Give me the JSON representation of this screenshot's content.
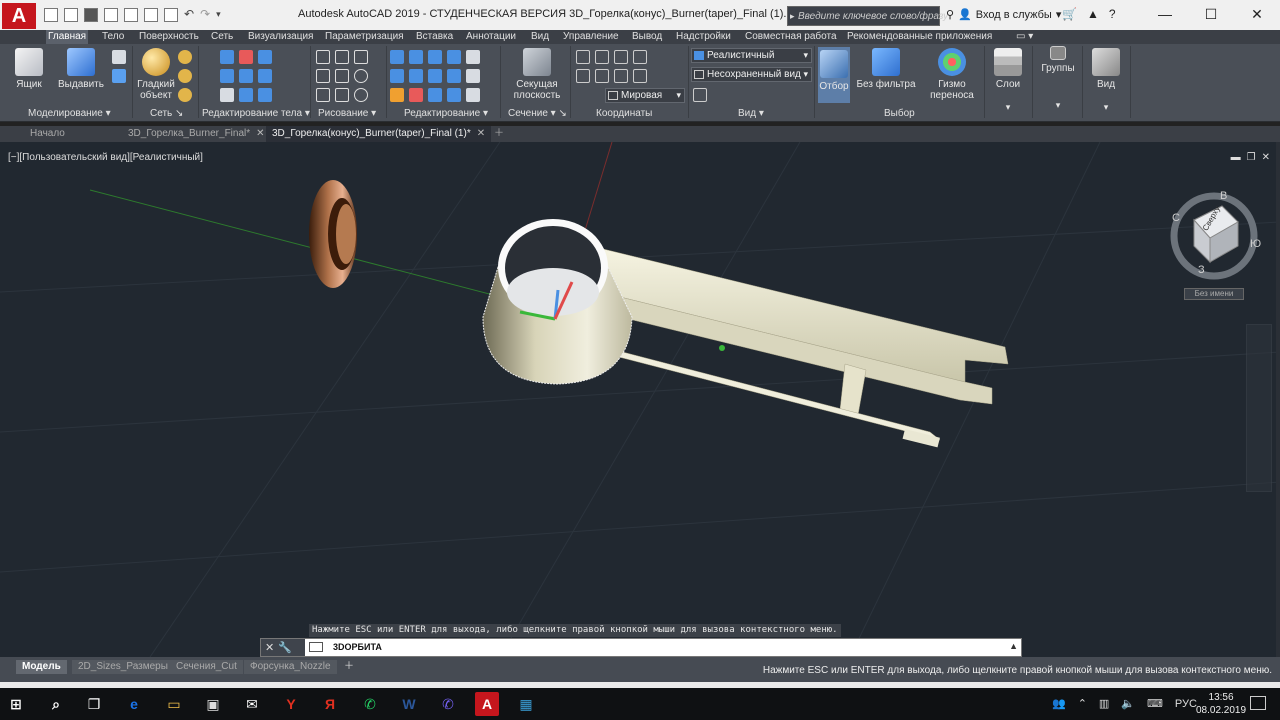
{
  "title_bar": {
    "app_logo": "A",
    "window_title": "Autodesk AutoCAD 2019 - СТУДЕНЧЕСКАЯ ВЕРСИЯ    3D_Горелка(конус)_Burner(taper)_Final (1).dwg",
    "search_placeholder": "Введите ключевое слово/фразу",
    "signin_label": "Вход в службы",
    "window_controls": [
      "—",
      "☐",
      "✕"
    ]
  },
  "ribbon_tabs": [
    "Главная",
    "Тело",
    "Поверхность",
    "Сеть",
    "Визуализация",
    "Параметризация",
    "Вставка",
    "Аннотации",
    "Вид",
    "Управление",
    "Вывод",
    "Надстройки",
    "Совместная работа",
    "Рекомендованные приложения"
  ],
  "ribbon": {
    "box_label": "Ящик",
    "extrude_label": "Выдавить",
    "smooth_label_1": "Гладкий",
    "smooth_label_2": "объект",
    "section_plane_label_1": "Секущая",
    "section_plane_label_2": "плоскость",
    "visual_style": "Реалистичный",
    "saved_view": "Несохраненный вид",
    "ucs": "Мировая",
    "culling_label": "Отбор",
    "no_filter_label": "Без фильтра",
    "gizmo_label_1": "Гизмо",
    "gizmo_label_2": "переноса",
    "layers_label": "Слои",
    "groups_label": "Группы",
    "view_label": "Вид",
    "panels": {
      "modeling": "Моделирование ▾",
      "mesh": "Сеть ↘",
      "solid_edit": "Редактирование тела ▾",
      "draw": "Рисование ▾",
      "modify": "Редактирование ▾",
      "section": "Сечение ▾ ↘",
      "coordinates": "Координаты",
      "view": "Вид ▾",
      "selection": "Выбор"
    }
  },
  "doc_tabs": [
    "Начало",
    "3D_Горелка_Burner_Final*",
    "3D_Горелка(конус)_Burner(taper)_Final (1)*"
  ],
  "viewport": {
    "label": "[−][Пользовательский вид][Реалистичный]",
    "viewcube_face": "Сверху",
    "compass": [
      "С",
      "В",
      "Ю",
      "З"
    ],
    "no_name": "Без имени"
  },
  "command": {
    "message": "Нажмите ESC или ENTER для выхода, либо щелкните правой кнопкой мыши для вызова контекстного меню.",
    "current": "3DОРБИТА"
  },
  "layout_tabs": [
    "Модель",
    "2D_Sizes_Размеры",
    "Сечения_Cut",
    "Форсунка_Nozzle"
  ],
  "status_message": "Нажмите ESC или ENTER для выхода, либо щелкните правой кнопкой мыши для вызова контекстного меню.",
  "taskbar": {
    "apps": [
      {
        "name": "windows-start",
        "glyph": "⊞",
        "color": "#ffffff"
      },
      {
        "name": "search",
        "glyph": "⌕",
        "color": "#ffffff"
      },
      {
        "name": "task-view",
        "glyph": "❐",
        "color": "#ffffff"
      },
      {
        "name": "edge",
        "glyph": "e",
        "color": "#1a73e8"
      },
      {
        "name": "explorer",
        "glyph": "▭",
        "color": "#f3c14b"
      },
      {
        "name": "store",
        "glyph": "▣",
        "color": "#dddddd"
      },
      {
        "name": "mail",
        "glyph": "✉",
        "color": "#ffffff"
      },
      {
        "name": "yandex-browser",
        "glyph": "Y",
        "color": "#e03020"
      },
      {
        "name": "yandex",
        "glyph": "Я",
        "color": "#e03020"
      },
      {
        "name": "whatsapp",
        "glyph": "✆",
        "color": "#25d366"
      },
      {
        "name": "word",
        "glyph": "W",
        "color": "#2b579a"
      },
      {
        "name": "viber",
        "glyph": "✆",
        "color": "#7360f2"
      },
      {
        "name": "autocad",
        "glyph": "A",
        "color": "#c5161d"
      },
      {
        "name": "photos",
        "glyph": "▦",
        "color": "#3aa0d8"
      }
    ],
    "lang": "РУС",
    "time": "13:56",
    "date": "08.02.2019"
  }
}
